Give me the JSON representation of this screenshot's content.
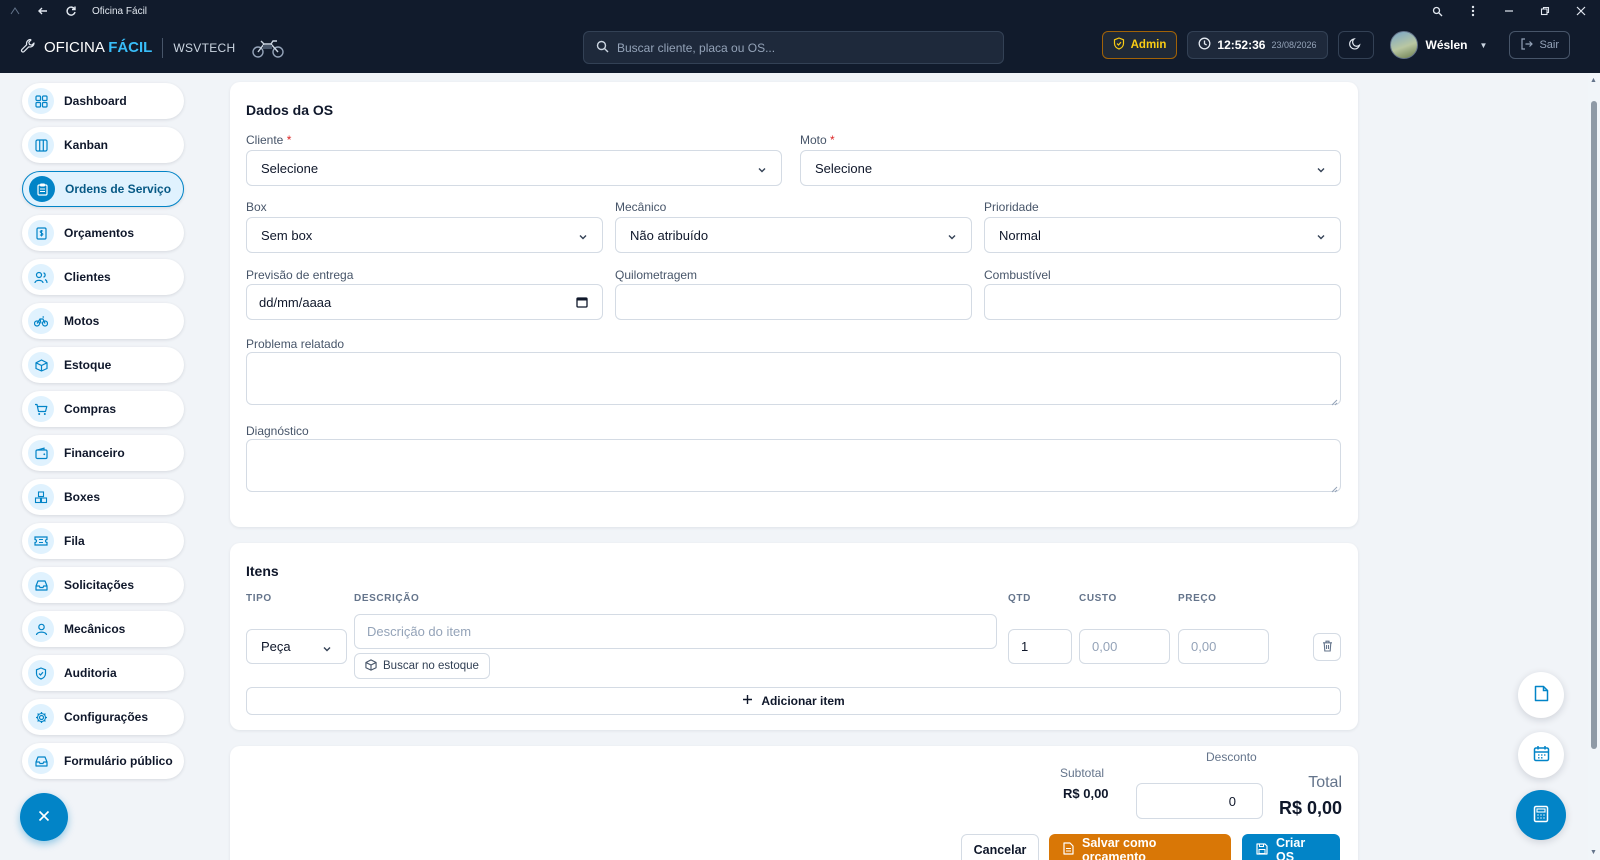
{
  "window": {
    "title": "Oficina Fácil"
  },
  "header": {
    "brand_main": "OFICINA",
    "brand_accent": "FÁCIL",
    "brand_sub": "WSVTECH",
    "search_placeholder": "Buscar cliente, placa ou OS...",
    "role": "Admin",
    "time": "12:52:36",
    "date": "23/08/2026",
    "user_name": "Wéslen",
    "logout_label": "Sair"
  },
  "sidebar": {
    "items": [
      {
        "label": "Dashboard",
        "icon": "dashboard-grid-icon"
      },
      {
        "label": "Kanban",
        "icon": "kanban-columns-icon"
      },
      {
        "label": "Ordens de Serviço",
        "icon": "clipboard-icon",
        "active": true
      },
      {
        "label": "Orçamentos",
        "icon": "receipt-dollar-icon"
      },
      {
        "label": "Clientes",
        "icon": "users-icon"
      },
      {
        "label": "Motos",
        "icon": "bike-icon"
      },
      {
        "label": "Estoque",
        "icon": "package-icon"
      },
      {
        "label": "Compras",
        "icon": "cart-icon"
      },
      {
        "label": "Financeiro",
        "icon": "wallet-icon"
      },
      {
        "label": "Boxes",
        "icon": "boxes-icon"
      },
      {
        "label": "Fila",
        "icon": "ticket-icon"
      },
      {
        "label": "Solicitações",
        "icon": "inbox-icon"
      },
      {
        "label": "Mecânicos",
        "icon": "user-icon"
      },
      {
        "label": "Auditoria",
        "icon": "shield-icon"
      },
      {
        "label": "Configurações",
        "icon": "gear-icon"
      },
      {
        "label": "Formulário público",
        "icon": "inbox-icon"
      }
    ]
  },
  "os_form": {
    "title": "Dados da OS",
    "cliente_label": "Cliente",
    "cliente_value": "Selecione",
    "moto_label": "Moto",
    "moto_value": "Selecione",
    "required_mark": "*",
    "box_label": "Box",
    "box_value": "Sem box",
    "mecanico_label": "Mecânico",
    "mecanico_value": "Não atribuído",
    "prioridade_label": "Prioridade",
    "prioridade_value": "Normal",
    "previsao_label": "Previsão de entrega",
    "previsao_value": "dd/mm/aaaa",
    "quilometragem_label": "Quilometragem",
    "quilometragem_value": "",
    "combustivel_label": "Combustível",
    "combustivel_value": "",
    "problema_label": "Problema relatado",
    "problema_value": "",
    "diagnostico_label": "Diagnóstico",
    "diagnostico_value": ""
  },
  "items": {
    "title": "Itens",
    "columns": {
      "tipo": "TIPO",
      "descricao": "DESCRIÇÃO",
      "qtd": "QTD",
      "custo": "CUSTO",
      "preco": "PREÇO"
    },
    "rows": [
      {
        "tipo": "Peça",
        "descricao_placeholder": "Descrição do item",
        "qtd": "1",
        "custo_placeholder": "0,00",
        "preco_placeholder": "0,00"
      }
    ],
    "buscar_label": "Buscar no estoque",
    "add_label": "Adicionar item"
  },
  "totals": {
    "subtotal_label": "Subtotal",
    "subtotal_value": "R$ 0,00",
    "desconto_label": "Desconto",
    "desconto_value": "0",
    "total_label": "Total",
    "total_value": "R$ 0,00",
    "cancel_label": "Cancelar",
    "save_budget_label": "Salvar como orçamento",
    "create_label": "Criar OS"
  },
  "colors": {
    "primary": "#0284c7",
    "warning": "#d97706",
    "header_bg": "#111b2c"
  }
}
